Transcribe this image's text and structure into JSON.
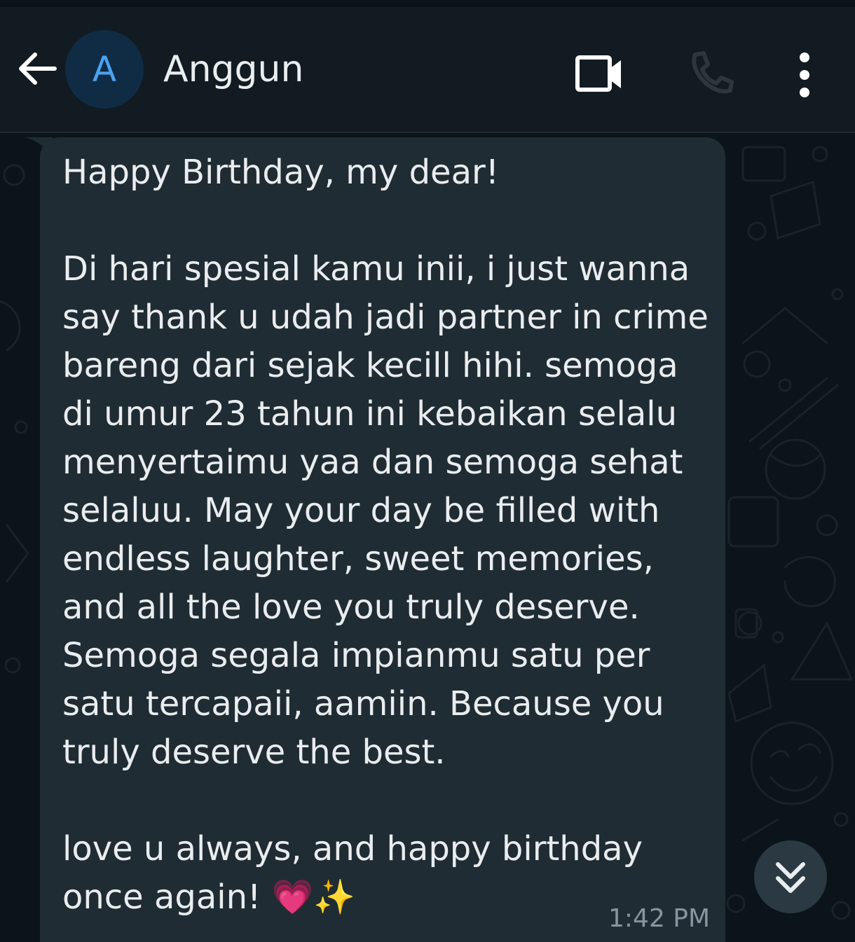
{
  "header": {
    "contact_name": "Anggun",
    "avatar_initial": "A",
    "icons": [
      "arrow-back-icon",
      "videocam-icon",
      "phone-icon",
      "more-vertical-icon"
    ]
  },
  "message": {
    "text": "Happy Birthday, my dear!\n\nDi hari spesial kamu inii, i just wanna say thank u udah jadi partner in crime bareng dari sejak kecill hihi. semoga di umur 23 tahun ini kebaikan selalu menyertaimu yaa dan semoga sehat selaluu. May your day be filled with endless laughter, sweet memories, and all the love you truly deserve. Semoga segala impianmu satu per satu tercapaii, aamiin. Because you truly deserve the best.\n\nlove u always, and happy birthday once again! 💗✨",
    "time": "1:42 PM"
  },
  "colors": {
    "chat_background": "#0b141a",
    "header_background": "#111b21",
    "bubble_background": "#202c33",
    "text": "#e9edef",
    "meta_text": "#8696a0",
    "avatar_background": "#102c45",
    "avatar_letter": "#4aa3f0"
  }
}
